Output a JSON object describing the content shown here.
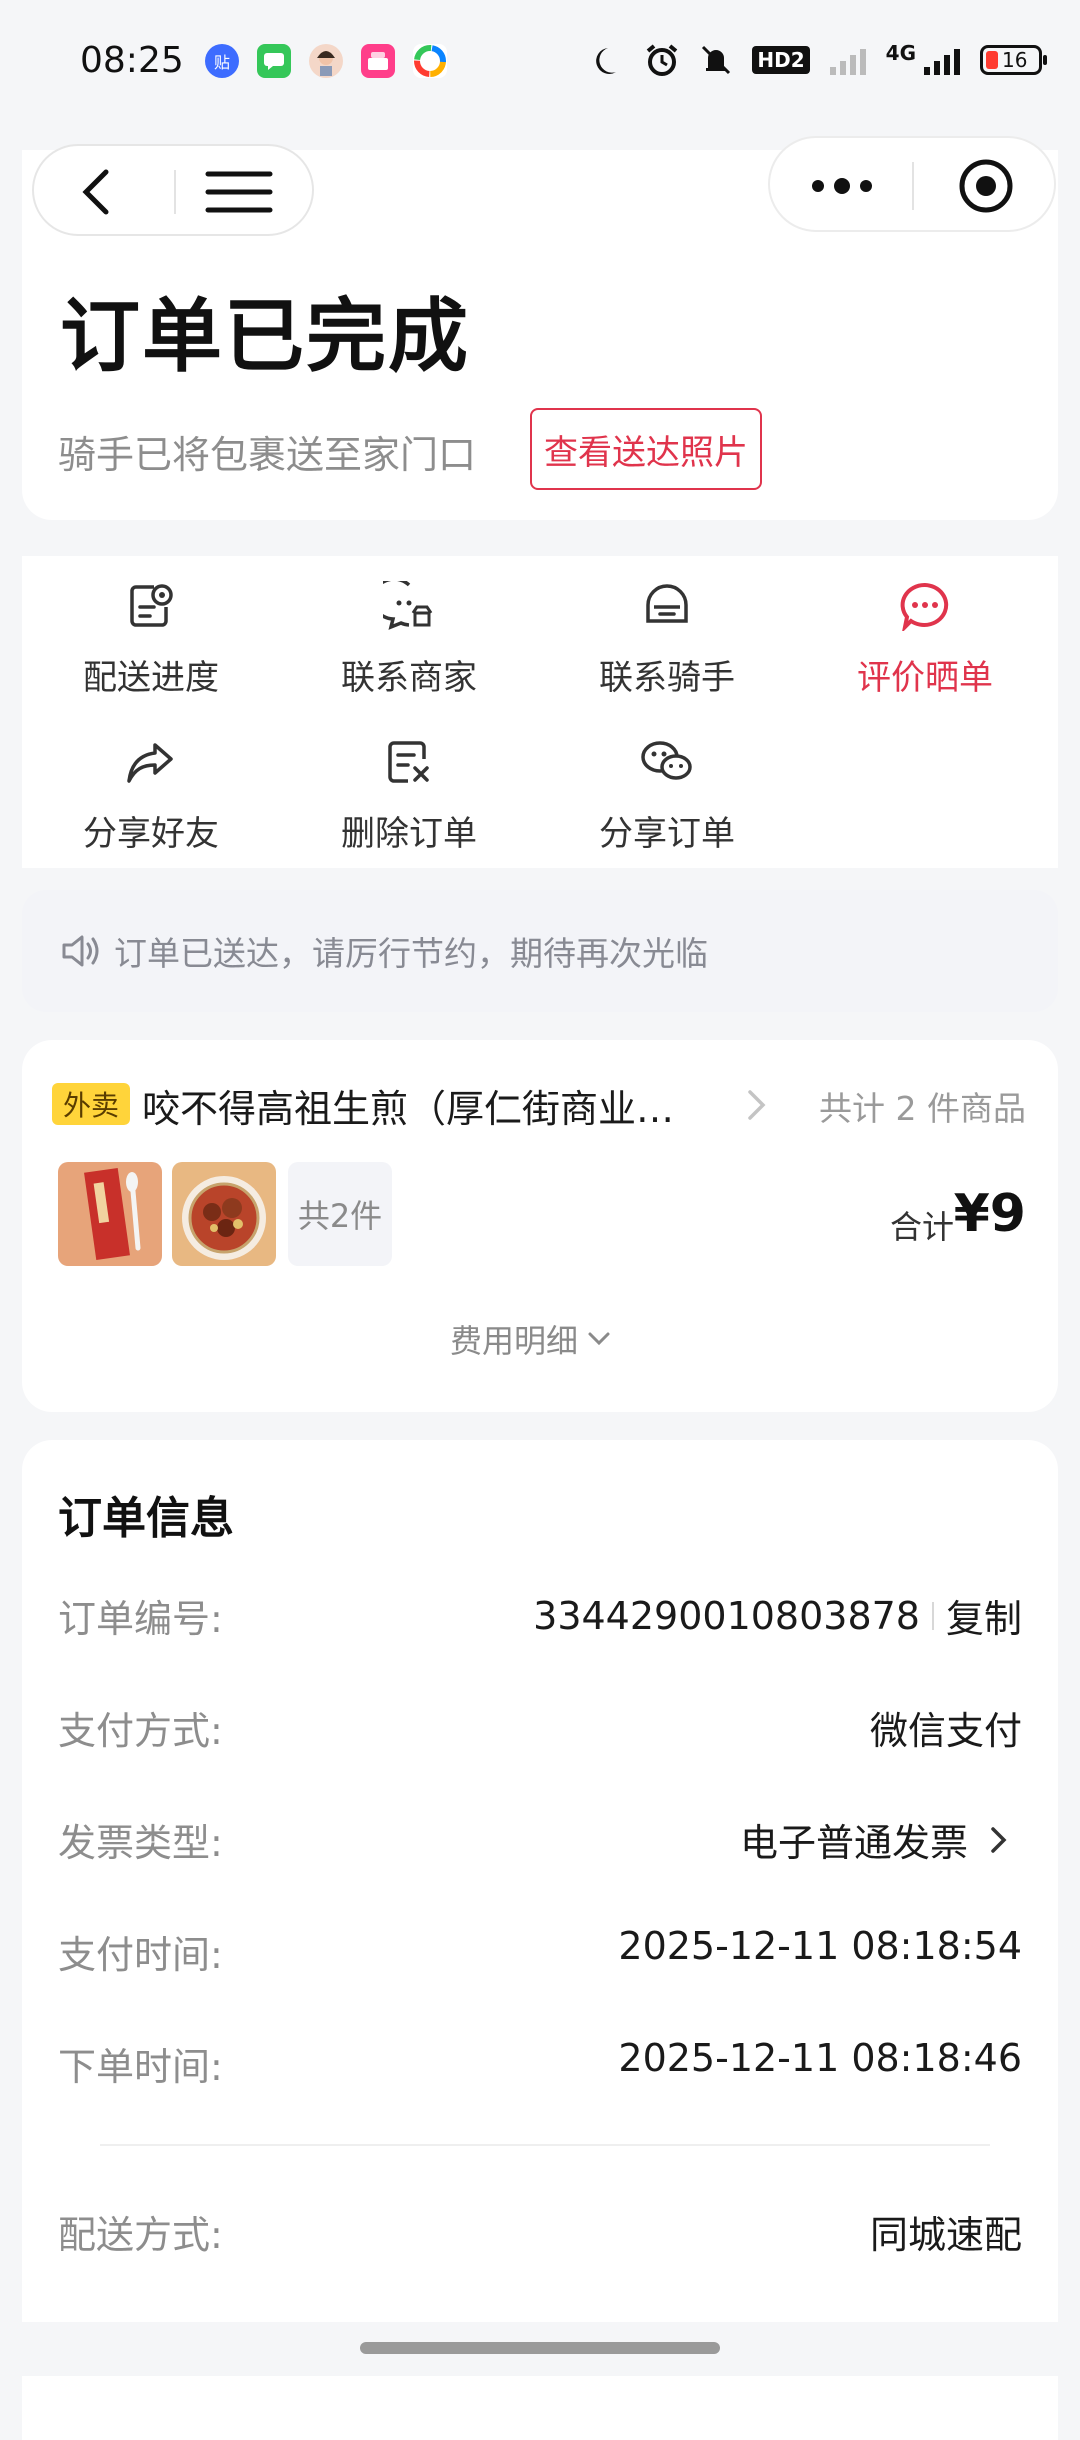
{
  "status_bar": {
    "time": "08:25",
    "app_icons": [
      "tieba-icon",
      "messages-icon",
      "avatar-icon",
      "promo-app-icon",
      "colorful-app-icon"
    ],
    "network": "4G",
    "hd_label": "HD2",
    "battery": "16"
  },
  "header": {
    "title": "订单已完成",
    "subtitle": "骑手已将包裹送至家门口",
    "photo_button": "查看送达照片"
  },
  "actions": [
    {
      "label": "配送进度",
      "icon": "delivery-progress-icon"
    },
    {
      "label": "联系商家",
      "icon": "contact-merchant-icon"
    },
    {
      "label": "联系骑手",
      "icon": "contact-rider-icon"
    },
    {
      "label": "评价晒单",
      "icon": "review-icon"
    },
    {
      "label": "分享好友",
      "icon": "share-icon"
    },
    {
      "label": "删除订单",
      "icon": "delete-order-icon"
    },
    {
      "label": "分享订单",
      "icon": "wechat-share-icon"
    }
  ],
  "notice": {
    "text": "订单已送达，请厉行节约，期待再次光临"
  },
  "store": {
    "badge": "外卖",
    "name": "咬不得高祖生煎（厚仁街商业…",
    "total_count": "共计 2 件商品",
    "more_items": "共2件",
    "sum_label": "合计",
    "sum_value": "¥9",
    "fee_detail": "费用明细"
  },
  "order_info": {
    "title": "订单信息",
    "rows": [
      {
        "label": "订单编号:",
        "value": "3344290010803878",
        "action": "复制"
      },
      {
        "label": "支付方式:",
        "value": "微信支付"
      },
      {
        "label": "发票类型:",
        "value": "电子普通发票"
      },
      {
        "label": "支付时间:",
        "value": "2025-12-11 08:18:54"
      },
      {
        "label": "下单时间:",
        "value": "2025-12-11 08:18:46"
      },
      {
        "label": "配送方式:",
        "value": "同城速配"
      }
    ]
  },
  "colors": {
    "accent_red": "#e0344c",
    "badge_yellow": "#ffd43a"
  }
}
